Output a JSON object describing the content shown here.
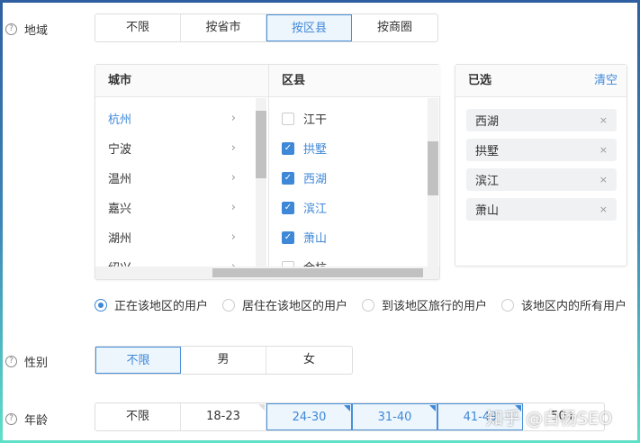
{
  "region": {
    "label": "地域",
    "options": [
      "不限",
      "按省市",
      "按区县",
      "按商圈"
    ],
    "selected": 2
  },
  "picker": {
    "city_header": "城市",
    "district_header": "区县",
    "cities": [
      "杭州",
      "宁波",
      "温州",
      "嘉兴",
      "湖州",
      "绍兴"
    ],
    "active_city": 0,
    "districts": [
      {
        "name": "江干",
        "checked": false
      },
      {
        "name": "拱墅",
        "checked": true
      },
      {
        "name": "西湖",
        "checked": true
      },
      {
        "name": "滨江",
        "checked": true
      },
      {
        "name": "萧山",
        "checked": true
      },
      {
        "name": "余杭",
        "checked": false
      }
    ]
  },
  "selected_panel": {
    "title": "已选",
    "clear": "清空",
    "tags": [
      "西湖",
      "拱墅",
      "滨江",
      "萧山"
    ],
    "remove_glyph": "×"
  },
  "user_types": {
    "options": [
      "正在该地区的用户",
      "居住在该地区的用户",
      "到该地区旅行的用户",
      "该地区内的所有用户"
    ],
    "selected": 0
  },
  "gender": {
    "label": "性别",
    "options": [
      "不限",
      "男",
      "女"
    ],
    "selected": 0
  },
  "age": {
    "label": "年龄",
    "options": [
      "不限",
      "18-23",
      "24-30",
      "31-40",
      "41-49",
      "50+"
    ],
    "selected": [
      2,
      3,
      4
    ]
  },
  "watermark": "知乎 @白杨SEO",
  "colors": {
    "accent": "#3f88d8"
  }
}
